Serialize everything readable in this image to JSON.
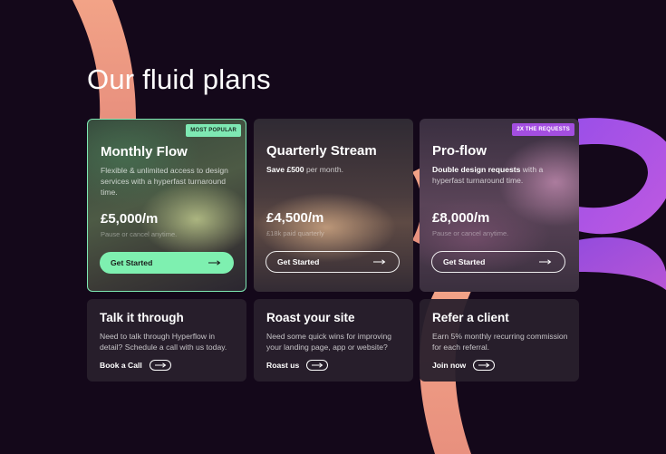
{
  "page": {
    "title": "Our fluid plans"
  },
  "colors": {
    "background": "#14081a",
    "accent_green": "#7ef0b0",
    "accent_purple": "#a34ee0",
    "ribbon_peach": "#f0a48a"
  },
  "plans": [
    {
      "badge": "MOST POPULAR",
      "name": "Monthly Flow",
      "description": "Flexible & unlimited access to design services with a hyperfast turnaround time.",
      "price": "£5,000/m",
      "note": "Pause or cancel anytime.",
      "cta": "Get Started"
    },
    {
      "badge": "",
      "name": "Quarterly Stream",
      "description_bold": "Save £500",
      "description_rest": " per month.",
      "price": "£4,500/m",
      "note": "£18k paid quarterly",
      "cta": "Get Started"
    },
    {
      "badge": "2X THE REQUESTS",
      "name": "Pro-flow",
      "description_bold": "Double design requests",
      "description_rest": " with a hyperfast turnaround time.",
      "price": "£8,000/m",
      "note": "Pause or cancel anytime.",
      "cta": "Get Started"
    }
  ],
  "info_cards": [
    {
      "title": "Talk it through",
      "description": "Need to talk through Hyperflow in detail? Schedule a call with us today.",
      "link": "Book a Call"
    },
    {
      "title": "Roast your site",
      "description": "Need some quick wins for improving your landing page, app or website?",
      "link": "Roast us"
    },
    {
      "title": "Refer a client",
      "description": "Earn 5% monthly recurring commission for each referral.",
      "link": "Join now"
    }
  ],
  "icons": {
    "arrow": "arrow-right-icon"
  }
}
